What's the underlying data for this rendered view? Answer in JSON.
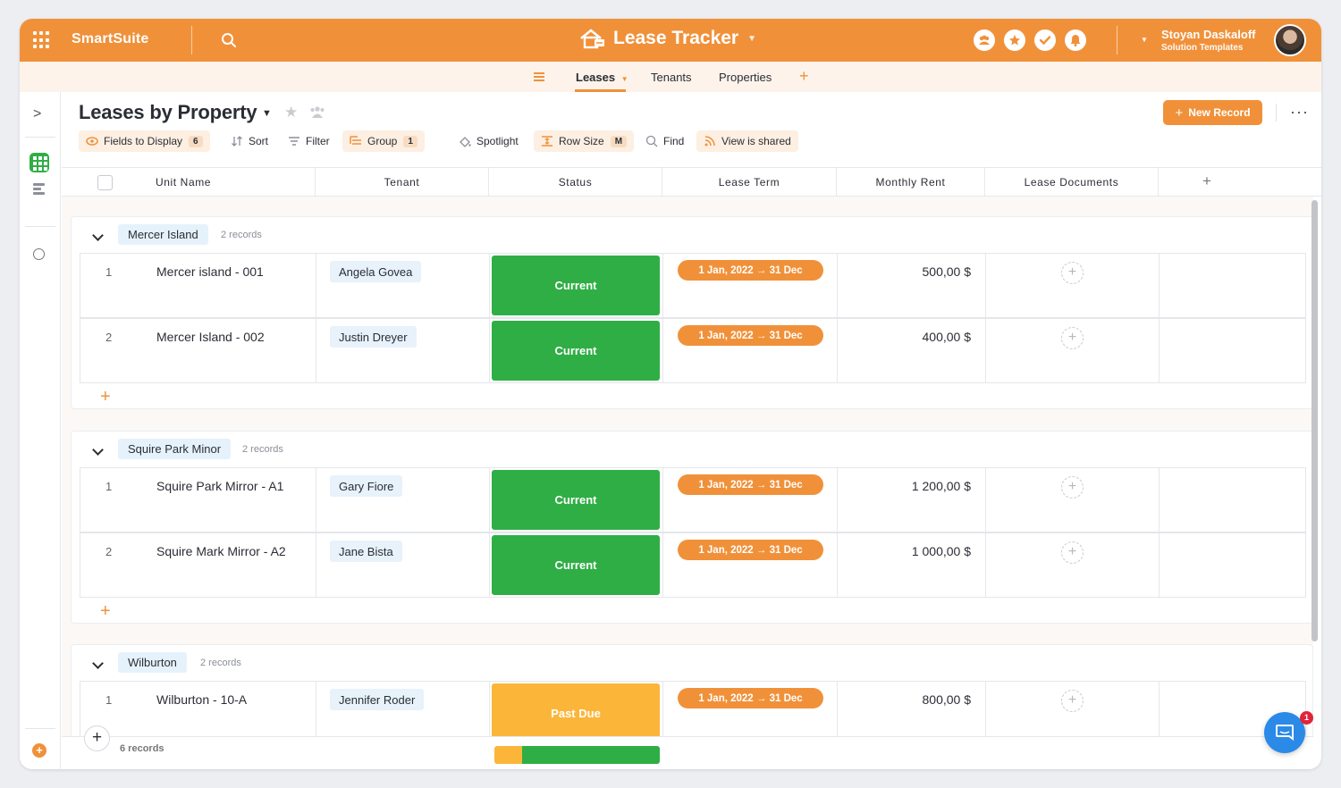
{
  "brand": "SmartSuite",
  "app": {
    "title": "Lease Tracker"
  },
  "user": {
    "name": "Stoyan Daskaloff",
    "role": "Solution Templates"
  },
  "tabs": [
    {
      "label": "Leases"
    },
    {
      "label": "Tenants"
    },
    {
      "label": "Properties"
    }
  ],
  "view": {
    "title": "Leases by Property",
    "new_record_label": "New Record"
  },
  "toolbar": {
    "fields_label": "Fields to Display",
    "fields_count": "6",
    "sort_label": "Sort",
    "filter_label": "Filter",
    "group_label": "Group",
    "group_count": "1",
    "spotlight_label": "Spotlight",
    "rowsize_label": "Row Size",
    "rowsize_value": "M",
    "find_label": "Find",
    "shared_label": "View is shared"
  },
  "columns": [
    "Unit Name",
    "Tenant",
    "Status",
    "Lease Term",
    "Monthly Rent",
    "Lease Documents"
  ],
  "groups": [
    {
      "name": "Mercer Island",
      "count": "2 records",
      "rows": [
        {
          "num": "1",
          "unit": "Mercer island - 001",
          "tenant": "Angela Govea",
          "status": "Current",
          "term": "1 Jan, 2022 → 31 Dec",
          "rent": "500,00 $"
        },
        {
          "num": "2",
          "unit": "Mercer Island - 002",
          "tenant": "Justin Dreyer",
          "status": "Current",
          "term": "1 Jan, 2022 → 31 Dec",
          "rent": "400,00 $"
        }
      ]
    },
    {
      "name": "Squire Park Minor",
      "count": "2 records",
      "rows": [
        {
          "num": "1",
          "unit": "Squire Park Mirror - A1",
          "tenant": "Gary Fiore",
          "status": "Current",
          "term": "1 Jan, 2022 → 31 Dec",
          "rent": "1 200,00 $"
        },
        {
          "num": "2",
          "unit": "Squire Mark Mirror - A2",
          "tenant": "Jane Bista",
          "status": "Current",
          "term": "1 Jan, 2022 → 31 Dec",
          "rent": "1 000,00 $"
        }
      ]
    },
    {
      "name": "Wilburton",
      "count": "2 records",
      "rows": [
        {
          "num": "1",
          "unit": "Wilburton - 10-A",
          "tenant": "Jennifer Roder",
          "status": "Past Due",
          "term": "1 Jan, 2022 → 31 Dec",
          "rent": "800,00 $"
        }
      ]
    }
  ],
  "footer": {
    "record_count": "6 records"
  },
  "chat": {
    "badge": "1"
  },
  "colors": {
    "brand_orange": "#f0913a",
    "status_current": "#2fae45",
    "status_past_due": "#fbb63a",
    "chat_blue": "#2b8ae8"
  }
}
